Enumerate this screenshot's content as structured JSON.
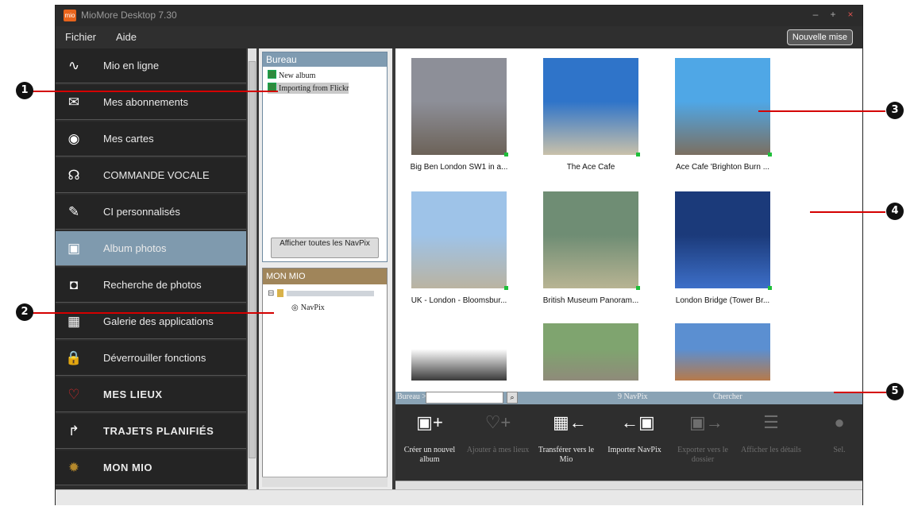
{
  "window": {
    "title": "MioMore Desktop 7.30",
    "logo": "mio",
    "controls": [
      "–",
      "+",
      "×"
    ]
  },
  "menubar": {
    "items": [
      "Fichier",
      "Aide"
    ],
    "new_button": "Nouvelle mise"
  },
  "sidebar": {
    "items": [
      {
        "label": "Mio en ligne",
        "icon": "signal-wave-icon",
        "glyph": "∿",
        "bold": false,
        "active": false
      },
      {
        "label": "Mes abonnements",
        "icon": "envelope-icon",
        "glyph": "✉",
        "bold": false,
        "active": false
      },
      {
        "label": "Mes cartes",
        "icon": "compass-icon",
        "glyph": "◉",
        "bold": false,
        "active": false
      },
      {
        "label": "COMMANDE VOCALE",
        "icon": "voice-icon",
        "glyph": "☊",
        "bold": false,
        "active": false
      },
      {
        "label": "CI personnalisés",
        "icon": "custom-poi-icon",
        "glyph": "✎",
        "bold": false,
        "active": false
      },
      {
        "label": "Album photos",
        "icon": "photo-album-icon",
        "glyph": "▣",
        "bold": false,
        "active": true
      },
      {
        "label": "Recherche de photos",
        "icon": "camera-icon",
        "glyph": "◘",
        "bold": false,
        "active": false
      },
      {
        "label": "Galerie des applications",
        "icon": "apps-grid-icon",
        "glyph": "▦",
        "bold": false,
        "active": false
      },
      {
        "label": "Déverrouiller fonctions",
        "icon": "padlock-icon",
        "glyph": "🔒",
        "bold": false,
        "active": false
      },
      {
        "label": "MES LIEUX",
        "icon": "heart-icon",
        "glyph": "♡",
        "bold": true,
        "active": false
      },
      {
        "label": "TRAJETS PLANIFIÉS",
        "icon": "route-icon",
        "glyph": "↱",
        "bold": true,
        "active": false
      },
      {
        "label": "MON MIO",
        "icon": "sun-gear-icon",
        "glyph": "✹",
        "bold": true,
        "active": false
      }
    ]
  },
  "bureau": {
    "title": "Bureau",
    "items": [
      "New album",
      "Importing from Flickr"
    ],
    "show_all_button": "Afficher toutes les NavPix"
  },
  "monmio": {
    "title": "MON MIO",
    "tree": [
      "NavPix"
    ]
  },
  "gallery": {
    "photos": [
      {
        "caption": "Big Ben London SW1 in a...",
        "colors": [
          "#8d8f98",
          "#6c6258"
        ]
      },
      {
        "caption": "The Ace Cafe",
        "colors": [
          "#2f74c9",
          "#c9c1aa"
        ]
      },
      {
        "caption": "Ace Cafe 'Brighton Burn ...",
        "colors": [
          "#4fa7e6",
          "#7b6f60"
        ]
      },
      {
        "caption": "UK - London - Bloomsbur...",
        "colors": [
          "#9ec3e8",
          "#bab3a1"
        ]
      },
      {
        "caption": "British Museum Panoram...",
        "colors": [
          "#6f8d74",
          "#b8b493"
        ]
      },
      {
        "caption": "London Bridge (Tower Br...",
        "colors": [
          "#1b3a7a",
          "#3d6fc8"
        ]
      },
      {
        "caption": "",
        "colors": [
          "#ffffff",
          "#3a3a3a"
        ]
      },
      {
        "caption": "",
        "colors": [
          "#7fa46f",
          "#8f8b7a"
        ]
      },
      {
        "caption": "",
        "colors": [
          "#5b8fd1",
          "#b77a4a"
        ]
      }
    ]
  },
  "breadcrumb": {
    "path": "Bureau > Importing from Flickr",
    "count": "9 NavPix",
    "search_label": "Chercher",
    "search_placeholder": ""
  },
  "toolbar": {
    "tools": [
      {
        "label": "Créer un nouvel album",
        "icon": "new-album-icon",
        "glyph": "▣+",
        "enabled": true
      },
      {
        "label": "Ajouter à mes lieux",
        "icon": "add-favorite-icon",
        "glyph": "♡+",
        "enabled": false
      },
      {
        "label": "Transférer vers le Mio",
        "icon": "transfer-to-mio-icon",
        "glyph": "▦←",
        "enabled": true
      },
      {
        "label": "Importer NavPix",
        "icon": "import-navpix-icon",
        "glyph": "←▣",
        "enabled": true
      },
      {
        "label": "Exporter vers le dossier",
        "icon": "export-icon",
        "glyph": "▣→",
        "enabled": false
      },
      {
        "label": "Afficher les détails",
        "icon": "details-list-icon",
        "glyph": "☰",
        "enabled": false
      },
      {
        "label": "Sel.",
        "icon": "pin-icon",
        "glyph": "●",
        "enabled": false
      }
    ]
  },
  "callouts": [
    "1",
    "2",
    "3",
    "4",
    "5"
  ],
  "accent_colors": {
    "annotation_line": "#d40000",
    "active_nav": "#7f9aae",
    "brand": "#e8641c"
  }
}
